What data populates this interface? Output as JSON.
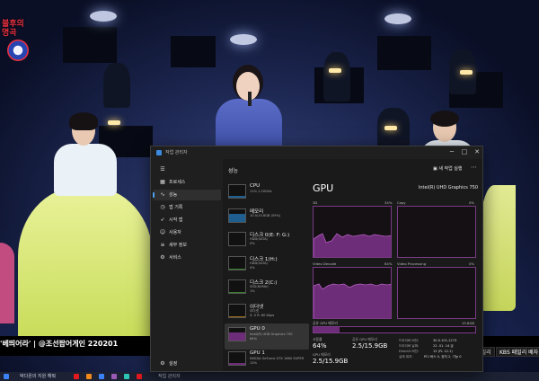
{
  "video": {
    "channel_logo_text": "불후의\n명곡",
    "title": "'베띄어라' | @조선팝어게인 220201",
    "chapter_chips": [
      "KBS 배전드 패밀리",
      "KBS 패밀리 배자"
    ]
  },
  "taskbar": {
    "items": [
      "박다온의 지원 해줘",
      "작업 관리자"
    ],
    "icon_colors": [
      "#e5181f",
      "#f28a1b",
      "#3b82f6",
      "#9b59b6",
      "#2ec4b6",
      "#e5181f"
    ]
  },
  "task_manager": {
    "window_title": "작업 관리자",
    "window_controls": [
      "─",
      "□",
      "✕"
    ],
    "nav": [
      {
        "icon": "hamburger-icon",
        "glyph": "☰",
        "label": ""
      },
      {
        "icon": "processes-icon",
        "glyph": "▦",
        "label": "프로세스"
      },
      {
        "icon": "performance-icon",
        "glyph": "∿",
        "label": "성능"
      },
      {
        "icon": "app-history-icon",
        "glyph": "◷",
        "label": "앱 기록"
      },
      {
        "icon": "startup-icon",
        "glyph": "➶",
        "label": "시작 앱"
      },
      {
        "icon": "users-icon",
        "glyph": "☺",
        "label": "사용자"
      },
      {
        "icon": "details-icon",
        "glyph": "≡",
        "label": "세부 정보"
      },
      {
        "icon": "services-icon",
        "glyph": "⚙",
        "label": "서비스"
      }
    ],
    "settings_label": "설정",
    "header": {
      "title": "성능",
      "run_task": "새 작업 실행",
      "more": "⋯"
    },
    "resources": [
      {
        "name": "CPU",
        "sub": "11% 1.20GHz",
        "value": "",
        "active": false,
        "fill_pct": 12
      },
      {
        "name": "메모리",
        "sub": "10.5/15.8GB (59%)",
        "value": "",
        "active": false,
        "fill_pct": 60
      },
      {
        "name": "디스크 0(E: F: G:)",
        "sub": "HDD(SATA)",
        "value": "0%",
        "active": false,
        "fill_pct": 2
      },
      {
        "name": "디스크 1(H:)",
        "sub": "HDD(SATA)",
        "value": "0%",
        "active": false,
        "fill_pct": 2
      },
      {
        "name": "디스크 2(C:)",
        "sub": "SSD(NVMe)",
        "value": "1%",
        "active": false,
        "fill_pct": 4
      },
      {
        "name": "이더넷",
        "sub": "이더넷",
        "value": "S: 0 R: 80 Kbps",
        "active": false,
        "fill_pct": 3
      },
      {
        "name": "GPU 0",
        "sub": "Intel(R) UHD Graphics 750",
        "value": "64%",
        "active": true,
        "fill_pct": 64
      },
      {
        "name": "GPU 1",
        "sub": "NVIDIA GeForce GTX 1660 SUPER",
        "value": "13%",
        "active": false,
        "fill_pct": 13
      }
    ],
    "detail": {
      "title": "GPU",
      "model": "Intel(R) UHD Graphics 750",
      "graphs": [
        {
          "label": "3D",
          "pct_label": "34%",
          "right_label": "Copy",
          "right_pct": "0%"
        },
        {
          "label": "Video Decode",
          "pct_label": "64%",
          "right_label": "Video Processing",
          "right_pct": "0%"
        }
      ],
      "shared_memory_label": "공유 GPU 메모리",
      "shared_memory_max": "15.8GB",
      "shared_memory_fraction": 0.16,
      "stats": [
        {
          "label": "사용률",
          "value": "64%"
        },
        {
          "label": "공유 GPU 메모리",
          "value": "2.5/15.9GB"
        },
        {
          "label": "GPU 메모리",
          "value": "2.5/15.9GB"
        }
      ],
      "info": [
        {
          "k": "드라이버 버전:",
          "v": "30.0.101.1273"
        },
        {
          "k": "드라이버 날짜:",
          "v": "22. 01. 14 금"
        },
        {
          "k": "DirectX 버전:",
          "v": "12 (FL 12.1)"
        },
        {
          "k": "실제 위치:",
          "v": "PCI 버스 0, 장치 2, 기능 0"
        }
      ]
    }
  }
}
